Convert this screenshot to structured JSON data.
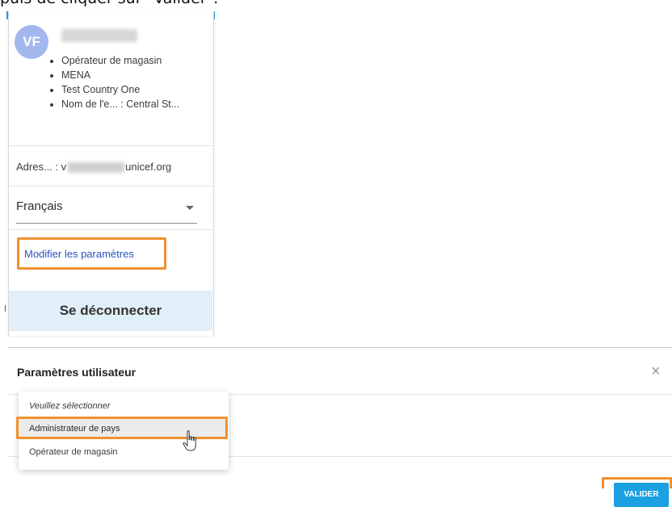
{
  "document": {
    "intro_line": "puis de cliquer sur \"Valider\"."
  },
  "user_menu": {
    "avatar_initials": "VF",
    "details": [
      "Opérateur de magasin",
      "MENA",
      "Test Country One",
      "Nom de l'e... : Central St..."
    ],
    "email_label": "Adres... :",
    "email_prefix": "v",
    "email_suffix": "unicef.org",
    "language": {
      "selected": "Français"
    },
    "modify_settings": "Modifier les paramètres",
    "logout": "Se déconnecter"
  },
  "settings_dialog": {
    "title": "Paramètres utilisateur",
    "close_icon": "×",
    "role_dropdown": {
      "placeholder": "Veuillez sélectionner",
      "options": [
        "Administrateur de pays",
        "Opérateur de magasin"
      ]
    },
    "submit": "VALIDER"
  },
  "colors": {
    "accent_orange": "#f0912d",
    "link_blue": "#2a52be",
    "avatar": "#a4b6ee",
    "logout_bg": "#e1eff8",
    "primary_button": "#1ba0e2"
  }
}
